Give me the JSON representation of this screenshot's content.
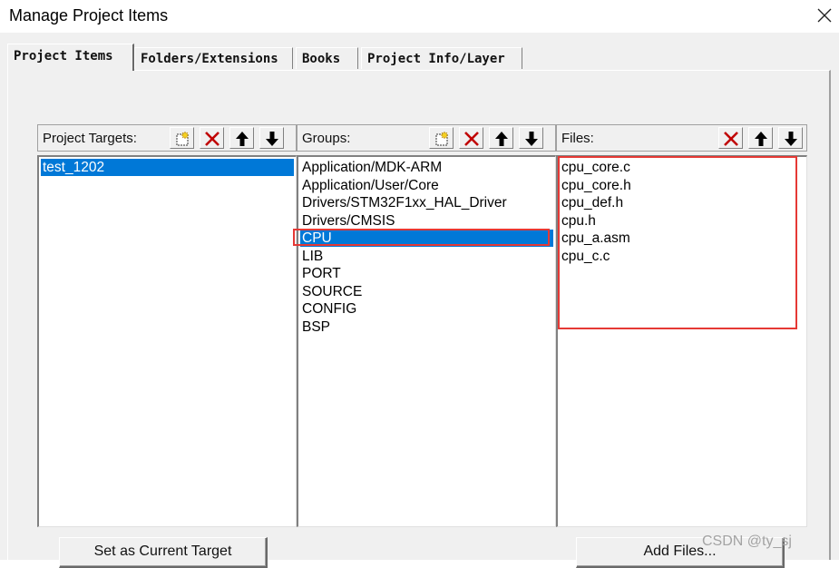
{
  "window": {
    "title": "Manage Project Items",
    "close_icon": "close-icon"
  },
  "tabs": [
    {
      "label": "Project Items",
      "active": true
    },
    {
      "label": "Folders/Extensions",
      "active": false
    },
    {
      "label": "Books",
      "active": false
    },
    {
      "label": "Project Info/Layer",
      "active": false
    }
  ],
  "targets": {
    "label": "Project Targets:",
    "toolbar": [
      "new-icon",
      "delete-icon",
      "move-up-icon",
      "move-down-icon"
    ],
    "items": [
      "test_1202"
    ],
    "selected": "test_1202",
    "set_current_button": "Set as Current Target"
  },
  "groups": {
    "label": "Groups:",
    "toolbar": [
      "new-icon",
      "delete-icon",
      "move-up-icon",
      "move-down-icon"
    ],
    "items": [
      "Application/MDK-ARM",
      "Application/User/Core",
      "Drivers/STM32F1xx_HAL_Driver",
      "Drivers/CMSIS",
      "CPU",
      "LIB",
      "PORT",
      "SOURCE",
      "CONFIG",
      "BSP"
    ],
    "selected": "CPU"
  },
  "files": {
    "label": "Files:",
    "toolbar": [
      "delete-icon",
      "move-up-icon",
      "move-down-icon"
    ],
    "items": [
      "cpu_core.c",
      "cpu_core.h",
      "cpu_def.h",
      "cpu.h",
      "cpu_a.asm",
      "cpu_c.c"
    ],
    "add_files_button": "Add Files..."
  },
  "annotation_color": "#e53935",
  "selection_color": "#0078d7",
  "watermark": "CSDN @ty_sj"
}
